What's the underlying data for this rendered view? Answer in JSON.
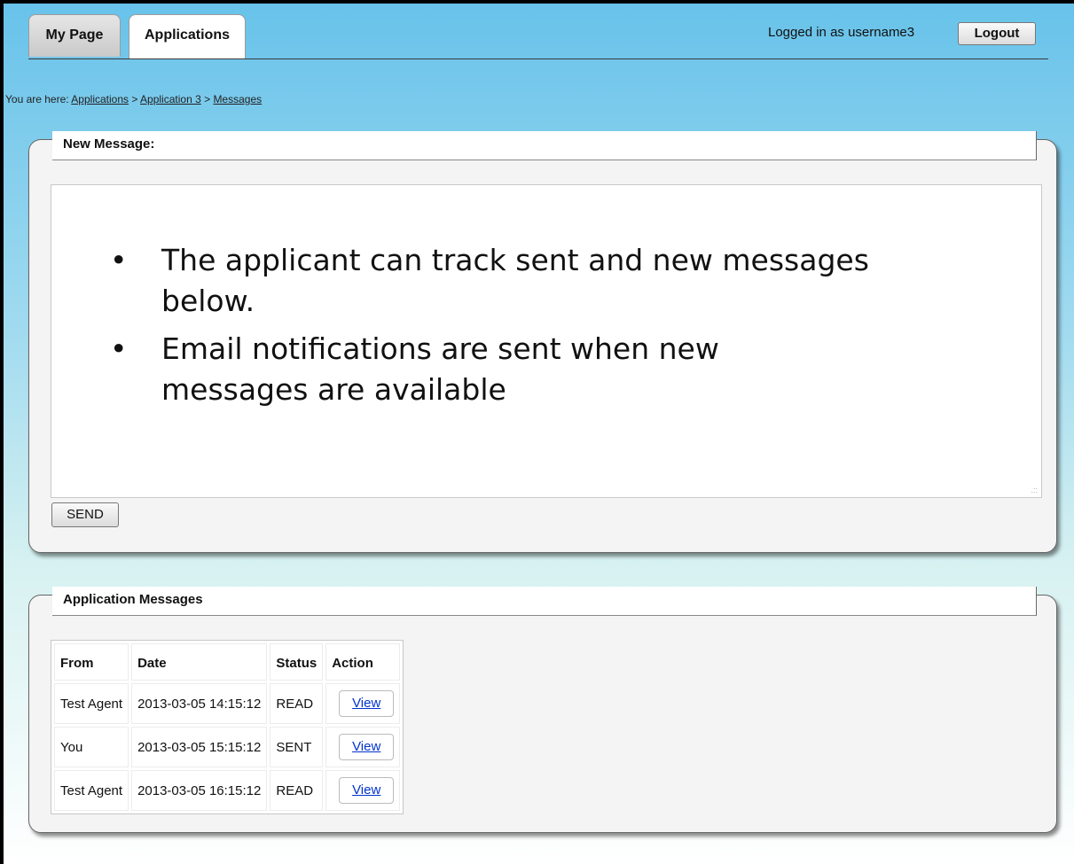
{
  "tabs": [
    {
      "label": "My Page"
    },
    {
      "label": "Applications"
    }
  ],
  "header": {
    "login_text": "Logged in as username3",
    "logout_label": "Logout"
  },
  "breadcrumb": {
    "prefix": "You are here: ",
    "items": [
      "Applications",
      "Application 3",
      "Messages"
    ],
    "separator": " > "
  },
  "new_message": {
    "legend": "New Message:",
    "bullets": [
      "The applicant can track sent and new messages below.",
      "Email notifications are sent when new messages are available"
    ],
    "send_label": "SEND"
  },
  "messages": {
    "legend": "Application Messages",
    "columns": [
      "From",
      "Date",
      "Status",
      "Action"
    ],
    "rows": [
      {
        "from": "Test Agent",
        "date": "2013-03-05 14:15:12",
        "status": "READ",
        "action": "View"
      },
      {
        "from": "You",
        "date": "2013-03-05 15:15:12",
        "status": "SENT",
        "action": "View"
      },
      {
        "from": "Test Agent",
        "date": "2013-03-05 16:15:12",
        "status": "READ",
        "action": "View"
      }
    ]
  },
  "icons": {
    "resize_grip": "resize-grip-icon"
  }
}
